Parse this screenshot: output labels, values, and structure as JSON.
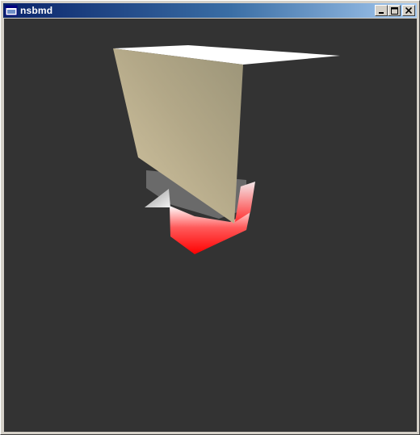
{
  "window": {
    "title": "nsbmd",
    "icon": "app-window-icon",
    "controls": [
      {
        "name": "minimize-button",
        "icon": "minimize-icon"
      },
      {
        "name": "maximize-button",
        "icon": "maximize-icon"
      },
      {
        "name": "close-button",
        "icon": "close-icon"
      }
    ]
  },
  "viewport": {
    "background_color": "#333333",
    "scene": "3D model render",
    "colors": {
      "panel_light": "#d6c8a4",
      "panel_dark": "#a39c80",
      "top_face": "#ffffff",
      "base_red": "#ff1a1a",
      "base_grey": "#6a6a6a",
      "spike": "#e6e6e6"
    }
  }
}
